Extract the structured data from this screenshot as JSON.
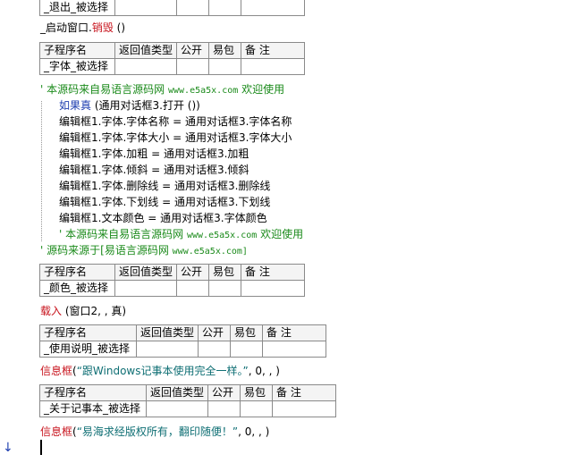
{
  "top_table": {
    "row": "_退出_被选择"
  },
  "line_qidong": {
    "prefix": "_启动窗口.",
    "method": "销毁",
    "args": "()"
  },
  "table_header": [
    "子程序名",
    "返回值类型",
    "公开",
    "易包",
    "备 注"
  ],
  "sub_font": {
    "name": "_字体_被选择"
  },
  "comment1": {
    "mark": "'",
    "text": "本源码来自易语言源码网",
    "url": "www.e5a5x.com",
    "tail": "欢迎使用"
  },
  "if_line": {
    "keyword": "如果真",
    "cond": "(通用对话框3.打开 ())"
  },
  "assign_lines": [
    "编辑框1.字体.字体名称 = 通用对话框3.字体名称",
    "编辑框1.字体.字体大小 = 通用对话框3.字体大小",
    "编辑框1.字体.加粗 = 通用对话框3.加粗",
    "编辑框1.字体.倾斜 = 通用对话框3.倾斜",
    "编辑框1.字体.删除线 = 通用对话框3.删除线",
    "编辑框1.字体.下划线 = 通用对话框3.下划线",
    "编辑框1.文本颜色 = 通用对话框3.字体颜色"
  ],
  "comment2": {
    "mark": "'",
    "text": "本源码来自易语言源码网",
    "url": "www.e5a5x.com",
    "tail": "欢迎使用"
  },
  "comment3": {
    "mark": "'",
    "text": "源码来源于[易语言源码网",
    "url": "www.e5a5x.com]"
  },
  "sub_color": {
    "name": "_颜色_被选择"
  },
  "load_line": {
    "func": "载入",
    "args": "(窗口2, , 真)"
  },
  "sub_help": {
    "name": "_使用说明_被选择"
  },
  "msg1": {
    "func": "信息框",
    "open": "(",
    "str": "“跟Windows记事本使用完全一样。”",
    "rest": ", 0, , )"
  },
  "sub_about": {
    "name": "_关于记事本_被选择"
  },
  "msg2": {
    "func": "信息框",
    "open": "(",
    "str": "“易海求经版权所有，翻印随便！”",
    "rest": ", 0, , )"
  },
  "gutter_arrow": "↓"
}
